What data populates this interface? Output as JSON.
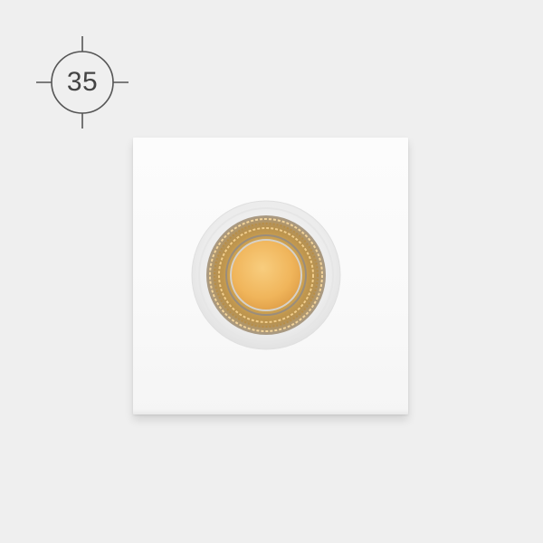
{
  "badge": {
    "value": "35",
    "icon": "crosshair-circle-icon"
  },
  "product": {
    "icon": "square-led-downlight-icon",
    "colors": {
      "background": "#efefef",
      "housing": "#fafafa",
      "led_core": "#f2b860",
      "reflector": "#c9a35a"
    }
  }
}
